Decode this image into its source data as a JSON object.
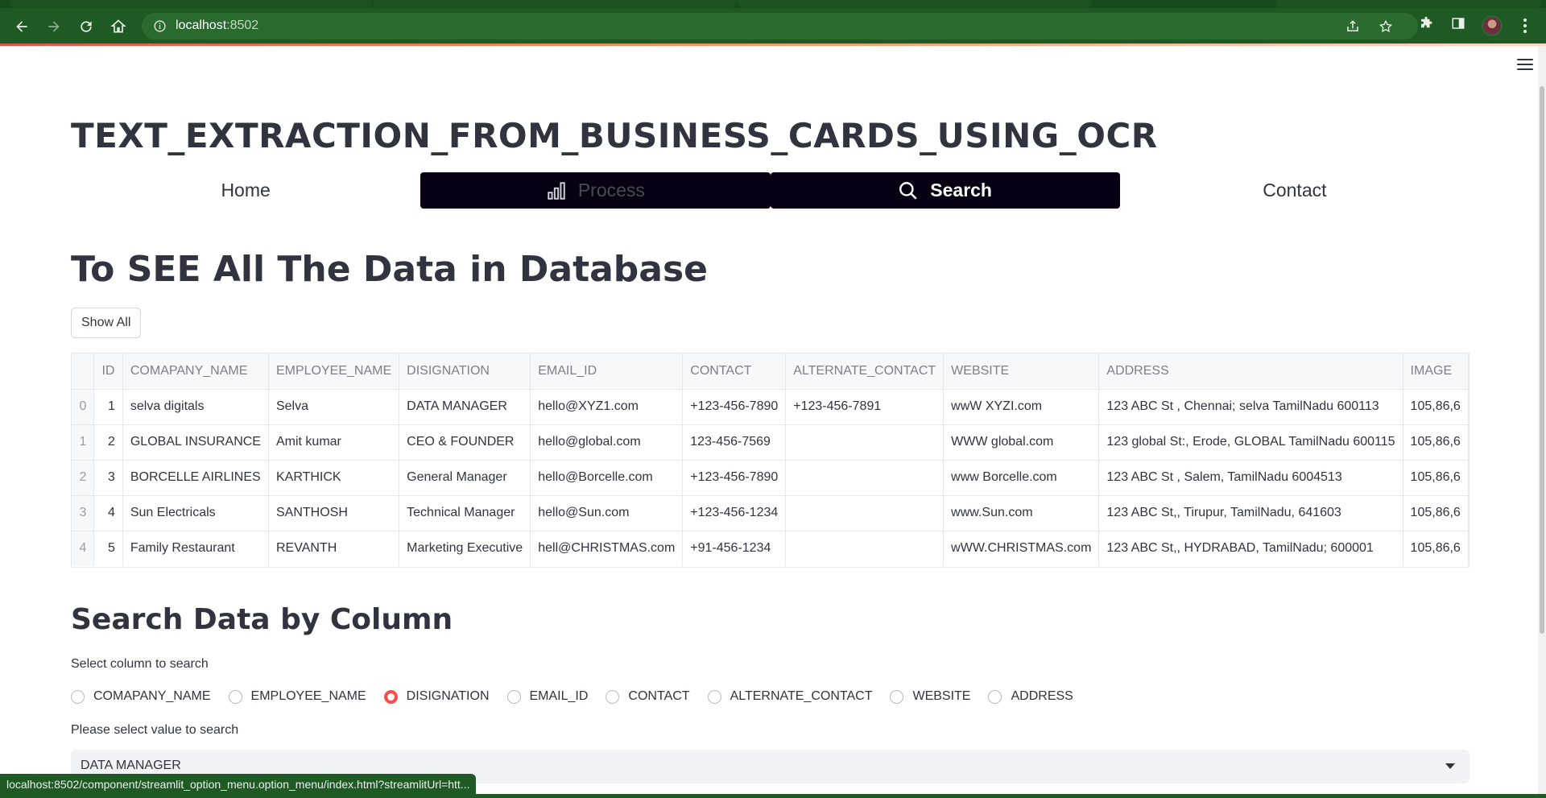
{
  "browser": {
    "url_host": "localhost",
    "url_port": ":8502",
    "status_url": "localhost:8502/component/streamlit_option_menu.option_menu/index.html?streamlitUrl=htt..."
  },
  "page": {
    "title": "TEXT_EXTRACTION_FROM_BUSINESS_CARDS_USING_OCR",
    "menu": [
      {
        "label": "Home",
        "icon": "none",
        "state": "normal"
      },
      {
        "label": "Process",
        "icon": "bar-chart-icon",
        "state": "dark"
      },
      {
        "label": "Search",
        "icon": "search-icon",
        "state": "active"
      },
      {
        "label": "Contact",
        "icon": "none",
        "state": "normal"
      }
    ],
    "section1_title": "To SEE All The Data in Database",
    "show_all_label": "Show All",
    "table": {
      "columns": [
        "",
        "ID",
        "COMAPANY_NAME",
        "EMPLOYEE_NAME",
        "DISIGNATION",
        "EMAIL_ID",
        "CONTACT",
        "ALTERNATE_CONTACT",
        "WEBSITE",
        "ADDRESS",
        "IMAGE"
      ],
      "rows": [
        [
          "0",
          "1",
          "selva digitals",
          "Selva",
          "DATA MANAGER",
          "hello@XYZ1.com",
          "+123-456-7890",
          "+123-456-7891",
          "wwW XYZI.com",
          "123 ABC St , Chennai; selva TamilNadu 600113",
          "105,86,6"
        ],
        [
          "1",
          "2",
          "GLOBAL INSURANCE",
          "Amit kumar",
          "CEO & FOUNDER",
          "hello@global.com",
          "123-456-7569",
          "",
          "WWW global.com",
          "123 global St:, Erode, GLOBAL TamilNadu 600115",
          "105,86,6"
        ],
        [
          "2",
          "3",
          "BORCELLE AIRLINES",
          "KARTHICK",
          "General Manager",
          "hello@Borcelle.com",
          "+123-456-7890",
          "",
          "www Borcelle.com",
          "123 ABC St , Salem, TamilNadu 6004513",
          "105,86,6"
        ],
        [
          "3",
          "4",
          "Sun Electricals",
          "SANTHOSH",
          "Technical Manager",
          "hello@Sun.com",
          "+123-456-1234",
          "",
          "www.Sun.com",
          "123 ABC St,, Tirupur, TamilNadu, 641603",
          "105,86,6"
        ],
        [
          "4",
          "5",
          "Family Restaurant",
          "REVANTH",
          "Marketing Executive",
          "hell@CHRISTMAS.com",
          "+91-456-1234",
          "",
          "wWW.CHRISTMAS.com",
          "123 ABC St,, HYDRABAD, TamilNadu; 600001",
          "105,86,6"
        ]
      ]
    },
    "section2_title": "Search Data by Column",
    "radio_label": "Select column to search",
    "radio_options": [
      "COMAPANY_NAME",
      "EMPLOYEE_NAME",
      "DISIGNATION",
      "EMAIL_ID",
      "CONTACT",
      "ALTERNATE_CONTACT",
      "WEBSITE",
      "ADDRESS"
    ],
    "radio_selected": "DISIGNATION",
    "select_label": "Please select value to search",
    "select_value": "DATA MANAGER",
    "accent_color": "#ff4b4b",
    "menu_active_bg": "#060012"
  }
}
